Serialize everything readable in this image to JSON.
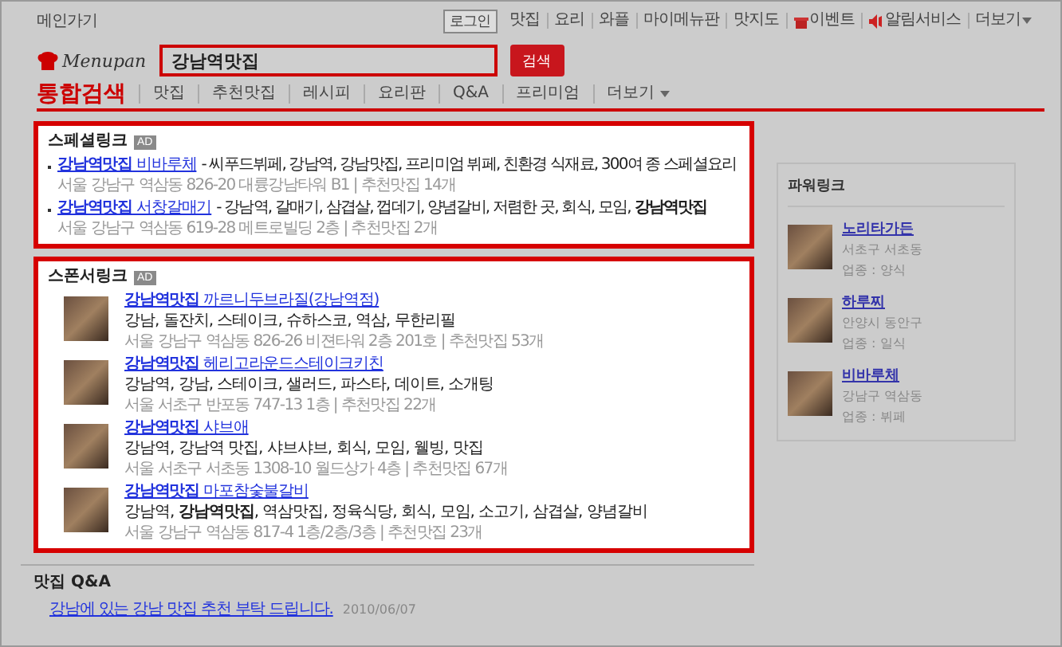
{
  "top_bar": {
    "home_link": "메인가기",
    "login": "로그인",
    "links": [
      {
        "label": "맛집",
        "kind": "text"
      },
      {
        "label": "요리",
        "kind": "text"
      },
      {
        "label": "와플",
        "kind": "text"
      },
      {
        "label": "마이메뉴판",
        "kind": "text"
      },
      {
        "label": "맛지도",
        "kind": "text"
      },
      {
        "label": "이벤트",
        "kind": "gift"
      },
      {
        "label": "알림서비스",
        "kind": "speaker"
      },
      {
        "label": "더보기",
        "kind": "dropdown"
      }
    ]
  },
  "logo": "Menupan",
  "search": {
    "value": "강남역맛집",
    "button": "검색"
  },
  "tabs": [
    {
      "label": "통합검색",
      "selected": true,
      "kind": "tab"
    },
    {
      "label": "맛집",
      "selected": false,
      "kind": "tab"
    },
    {
      "label": "추천맛집",
      "selected": false,
      "kind": "tab"
    },
    {
      "label": "레시피",
      "selected": false,
      "kind": "tab"
    },
    {
      "label": "요리판",
      "selected": false,
      "kind": "tab"
    },
    {
      "label": "Q&A",
      "selected": false,
      "kind": "tab"
    },
    {
      "label": "프리미엄",
      "selected": false,
      "kind": "tab"
    },
    {
      "label": "더보기",
      "selected": false,
      "kind": "dropdown"
    }
  ],
  "special_links": {
    "title": "스페셜링크",
    "badge": "AD",
    "items": [
      {
        "link": "**강남역맛집** 비바루체",
        "description": "- 씨푸드뷔페, 강남역, 강남맛집, 프리미엄 뷔페, 친환경 식재료, 300여 종 스페셜요리",
        "address": "서울 강남구 역삼동 826-20 대륭강남타워 B1 | 추천맛집 14개"
      },
      {
        "link": "**강남역맛집** 서창갈매기",
        "description": "- 강남역, 갈매기, 삼겹살, 껍데기, 양념갈비, 저렴한 곳, 회식, 모임, **강남역맛집**",
        "address": "서울 강남구 역삼동 619-28 메트로빌딩 2층 | 추천맛집 2개"
      }
    ]
  },
  "sponsor_links": {
    "title": "스폰서링크",
    "badge": "AD",
    "items": [
      {
        "link": "**강남역맛집** 까르니두브라질(강남역점)",
        "tags": "강남, 돌잔치, 스테이크, 슈하스코, 역삼, 무한리필",
        "address": "서울 강남구 역삼동 826-26 비젼타워 2층 201호 | 추천맛집 53개"
      },
      {
        "link": "**강남역맛집** 헤리고라운드스테이크키친",
        "tags": "강남역, 강남, 스테이크, 샐러드, 파스타, 데이트, 소개팅",
        "address": "서울 서초구 반포동 747-13 1층 | 추천맛집 22개"
      },
      {
        "link": "**강남역맛집** 샤브애",
        "tags": "강남역, 강남역 맛집, 샤브샤브, 회식, 모임, 웰빙, 맛집",
        "address": "서울 서초구 서초동 1308-10 월드상가 4층 | 추천맛집 67개"
      },
      {
        "link": "**강남역맛집** 마포참숯불갈비",
        "tags": "강남역, **강남역맛집**, 역삼맛집, 정육식당, 회식, 모임, 소고기, 삼겹살, 양념갈비",
        "address": "서울 강남구 역삼동 817-4 1층/2층/3층 | 추천맛집 23개"
      }
    ]
  },
  "qa": {
    "title": "맛집 Q&A",
    "items": [
      {
        "question": "강남에 있는 강남 맛집 추천 부탁 드립니다.",
        "date": "2010/06/07"
      }
    ]
  },
  "power_links": {
    "title": "파워링크",
    "items": [
      {
        "name": "노리타가든",
        "area": "서초구 서초동",
        "category": "업종 : 양식"
      },
      {
        "name": "하루찌",
        "area": "안양시 동안구",
        "category": "업종 : 일식"
      },
      {
        "name": "비바루체",
        "area": "강남구 역삼동",
        "category": "업종 : 뷔페"
      }
    ]
  }
}
